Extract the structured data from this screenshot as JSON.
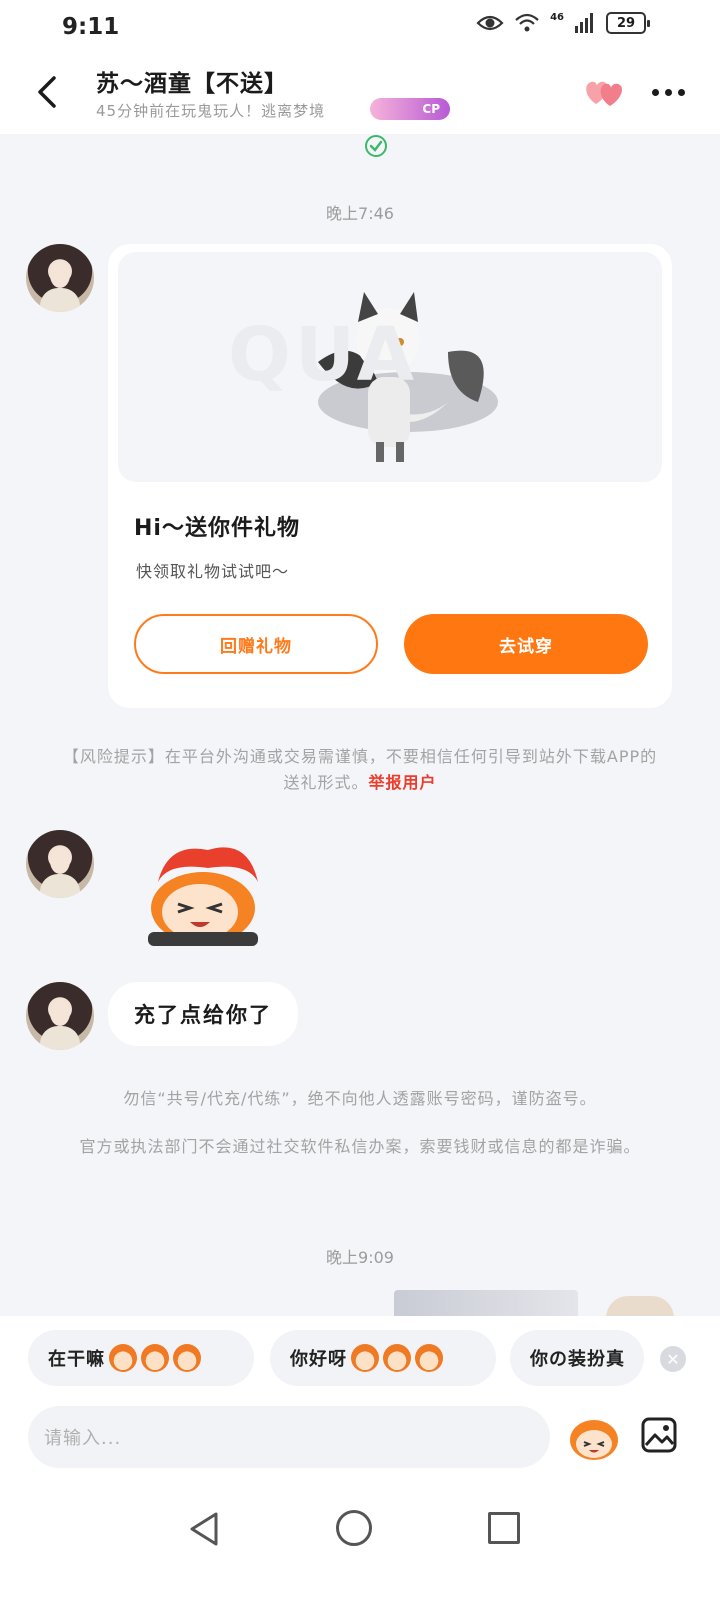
{
  "status_bar": {
    "time": "9:11",
    "network": "46",
    "battery": "29",
    "icons": [
      "eye-icon",
      "wifi-icon",
      "signal-icon",
      "battery-icon"
    ]
  },
  "header": {
    "title": "苏～酒童【不送】",
    "subtitle": "45分钟前在玩鬼玩人！逃离梦境",
    "badge": "CP",
    "icons": [
      "back-icon",
      "hearts-icon",
      "more-icon"
    ]
  },
  "messages": {
    "time_1": "晚上7:46",
    "gift_card": {
      "title": "Hi～送你件礼物",
      "subtitle": "快领取礼物试试吧～",
      "return_button": "回赠礼物",
      "try_button": "去试穿"
    },
    "risk_notice": "【风险提示】在平台外沟通或交易需谨慎，不要相信任何引导到站外下载APP的送礼形式。",
    "report_link": "举报用户",
    "text_message": "充了点给你了",
    "warning_1": "勿信“共号/代充/代练”，绝不向他人透露账号密码，谨防盗号。",
    "warning_2": "官方或执法部门不会通过社交软件私信办案，索要钱财或信息的都是诈骗。",
    "time_2": "晚上9:09"
  },
  "quick_replies": [
    "在干嘛",
    "你好呀",
    "你の装扮真"
  ],
  "input": {
    "placeholder": "请输入..."
  },
  "colors": {
    "accent": "#ff7711",
    "report": "#ee3b2b",
    "background": "#f3f5f8"
  }
}
